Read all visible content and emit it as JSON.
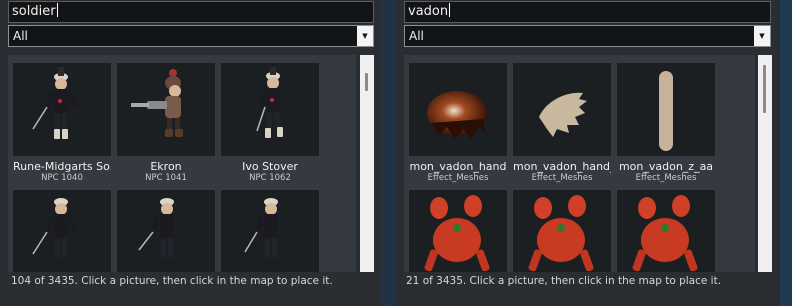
{
  "left_panel": {
    "search_value": "soldier",
    "filter_selected": "All",
    "status_text": "104 of 3435.  Click a picture, then click in the map to place it.",
    "tiles": [
      {
        "name": "Rune-Midgarts Soldier",
        "display_name": "Rune-Midgarts So...",
        "sub": "NPC 1040",
        "icon": "soldier-model-icon"
      },
      {
        "name": "Ekron",
        "display_name": "Ekron",
        "sub": "NPC 1041",
        "icon": "ekron-model-icon"
      },
      {
        "name": "Ivo Stover",
        "display_name": "Ivo Stover",
        "sub": "NPC 1062",
        "icon": "soldier-model-icon"
      },
      {
        "name": "",
        "display_name": "",
        "sub": "",
        "icon": "soldier-model-icon"
      },
      {
        "name": "",
        "display_name": "",
        "sub": "",
        "icon": "soldier-model-icon"
      },
      {
        "name": "",
        "display_name": "",
        "sub": "",
        "icon": "soldier-model-icon"
      }
    ]
  },
  "right_panel": {
    "search_value": "vadon",
    "filter_selected": "All",
    "status_text": "21 of 3435.  Click a picture, then click in the map to place it.",
    "tiles": [
      {
        "name": "mon_vadon_hand",
        "display_name": "mon_vadon_hand",
        "sub": "Effect_Meshes",
        "icon": "vadon-hand-mesh-icon"
      },
      {
        "name": "mon_vadon_hand_c",
        "display_name": "mon_vadon_hand_c",
        "sub": "Effect_Meshes",
        "icon": "vadon-claw-mesh-icon"
      },
      {
        "name": "mon_vadon_z_aa",
        "display_name": "mon_vadon_z_aa",
        "sub": "Effect_Meshes",
        "icon": "vadon-bar-mesh-icon"
      },
      {
        "name": "",
        "display_name": "",
        "sub": "",
        "icon": "vadon-crab-icon"
      },
      {
        "name": "",
        "display_name": "",
        "sub": "",
        "icon": "vadon-crab-icon"
      },
      {
        "name": "",
        "display_name": "",
        "sub": "",
        "icon": "vadon-crab-icon"
      }
    ]
  }
}
